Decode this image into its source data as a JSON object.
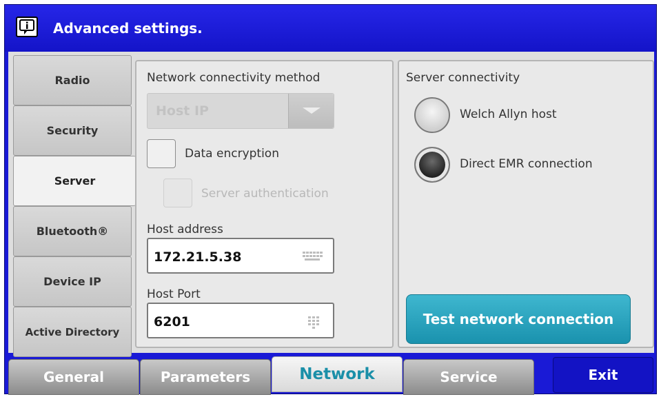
{
  "window": {
    "title": "Advanced settings.",
    "title_icon": "info-speech-icon"
  },
  "side_tabs": [
    {
      "label": "Radio",
      "active": false
    },
    {
      "label": "Security",
      "active": false
    },
    {
      "label": "Server",
      "active": true
    },
    {
      "label": "Bluetooth®",
      "active": false
    },
    {
      "label": "Device IP",
      "active": false
    },
    {
      "label": "Active Directory",
      "active": false
    }
  ],
  "network": {
    "method_label": "Network connectivity method",
    "method_value": "Host IP",
    "data_encryption_label": "Data encryption",
    "data_encryption_checked": false,
    "server_auth_label": "Server authentication",
    "server_auth_enabled": false,
    "host_address_label": "Host address",
    "host_address_value": "172.21.5.38",
    "host_port_label": "Host Port",
    "host_port_value": "6201"
  },
  "server_connectivity": {
    "label": "Server connectivity",
    "options": [
      {
        "label": "Welch Allyn host",
        "selected": false
      },
      {
        "label": "Direct EMR connection",
        "selected": true
      }
    ],
    "test_button_label": "Test network connection"
  },
  "bottom_tabs": [
    {
      "label": "General",
      "active": false
    },
    {
      "label": "Parameters",
      "active": false
    },
    {
      "label": "Network",
      "active": true
    },
    {
      "label": "Service",
      "active": false
    }
  ],
  "exit_label": "Exit",
  "colors": {
    "title_bar": "#1a1ad6",
    "accent_teal": "#1a92ae",
    "active_tab_text": "#1a8fa8"
  }
}
